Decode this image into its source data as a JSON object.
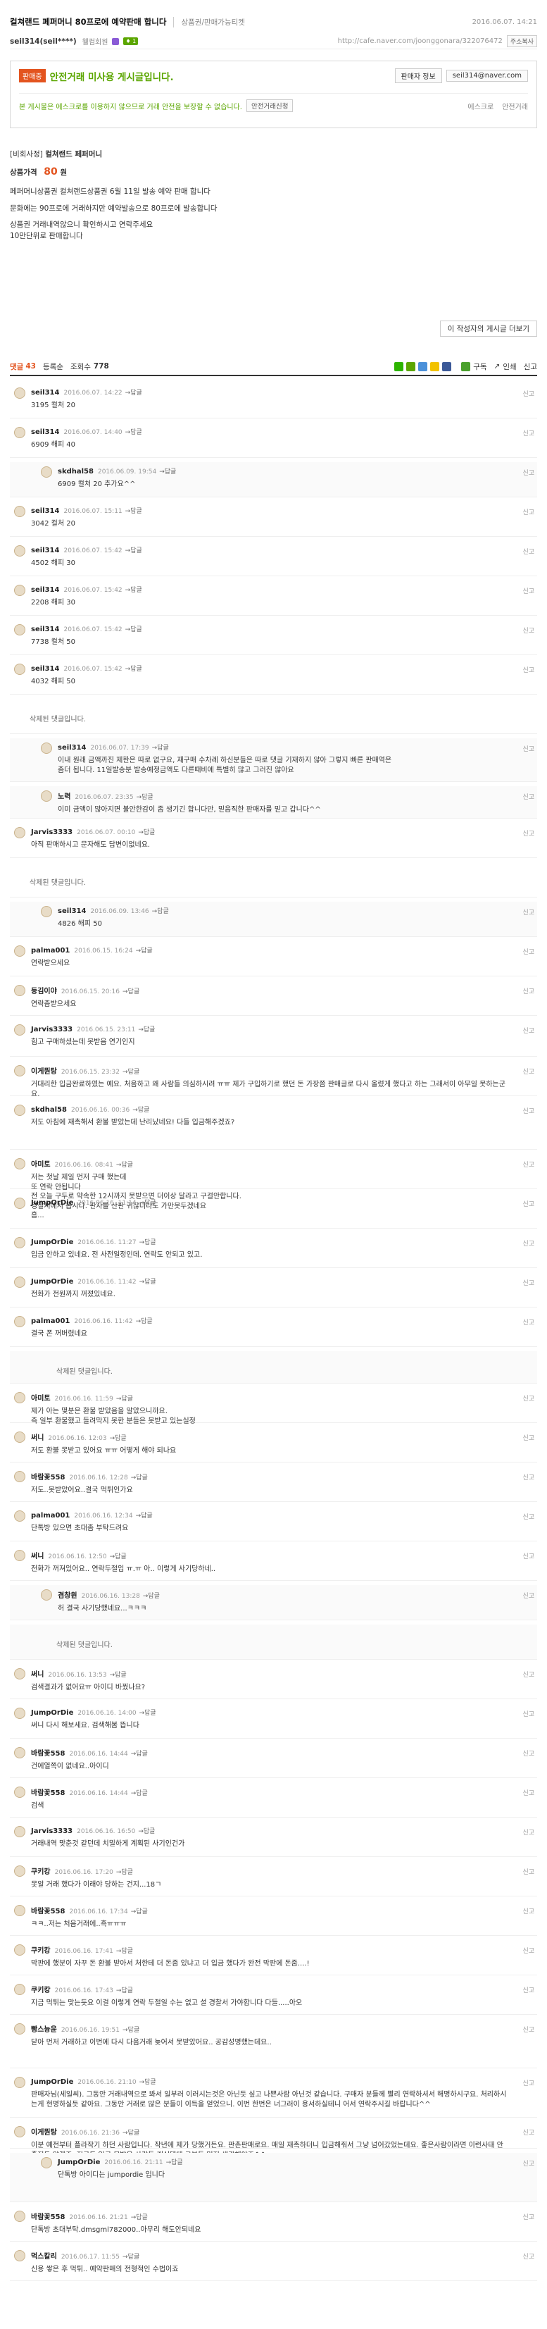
{
  "header": {
    "title": "컬쳐랜드 페퍼머니 80프로에 예약판매 합니다",
    "category": "상품권/판매가능티켓",
    "date": "2016.06.07. 14:21"
  },
  "author": {
    "name": "seil314(seil****)",
    "level": "웰컴회원",
    "badge": "♦ 1",
    "url": "http://cafe.naver.com/joonggonara/322076472",
    "copy": "주소복사"
  },
  "safe": {
    "badge": "판매중",
    "title": "안전거래 미사용 게시글입니다.",
    "seller_info": "판매자 정보",
    "email": "seil314@naver.com",
    "notice": "본 게시물은 에스크로를 이용하지 않으므로 거래 안전을 보장할 수 없습니다.",
    "link": "안전거래신청",
    "escrow": "에스크로",
    "safe_label": "안전거래"
  },
  "post": {
    "tag": "[비회사정]",
    "title": "컬쳐랜드 페퍼머니",
    "price_label": "상품가격",
    "price": "80",
    "price_unit": "원",
    "p1": "페퍼머니상품권 컬쳐랜드상품권 6월 11일 발송 예약 판매 합니다",
    "p2": "문화에는 90프로에 거래하지만 예약발송으로 80프로에 발송합니다",
    "p3": "상품권 거래내역않으니 확인하시고 연락주세요",
    "p4": "10만단위로 판매합니다",
    "more": "이 작성자의 게시글 더보기"
  },
  "comment_bar": {
    "label": "댓글",
    "count": "43",
    "sort": "등록순",
    "views_label": "조회수",
    "views": "778",
    "subscribe": "구독",
    "print": "인쇄",
    "report": "신고"
  },
  "comments": [
    {
      "nick": "seil314",
      "date": "2016.06.07. 14:22",
      "text": "3195 컬처 20"
    },
    {
      "nick": "seil314",
      "date": "2016.06.07. 14:40",
      "text": "6909 해피 40"
    },
    {
      "nick": "skdhal58",
      "date": "2016.06.09. 19:54",
      "text": "6909 컬처 20 추가요^^"
    },
    {
      "nick": "seil314",
      "date": "2016.06.07. 15:11",
      "text": "3042 컬처 20"
    },
    {
      "nick": "seil314",
      "date": "2016.06.07. 15:42",
      "text": "4502 해피 30"
    },
    {
      "nick": "seil314",
      "date": "2016.06.07. 15:42",
      "text": "2208 해피 30"
    },
    {
      "nick": "seil314",
      "date": "2016.06.07. 15:42",
      "text": "7738 컬처 50"
    },
    {
      "nick": "seil314",
      "date": "2016.06.07. 15:42",
      "text": "4032 해피 50"
    },
    {
      "nick": "",
      "date": "",
      "text": "삭제된 댓글입니다."
    },
    {
      "nick": "seil314",
      "date": "2016.06.07. 17:39",
      "text": "이내 원래 금액까진 제한은 따로 없구요, 재구매 수차례 하신분들은 따로 댓글 기재하지 않아 그렇지 빠른 판매역은\n좀더 됩니다. 11일발송분 발송예정금액도 다른때비에 특별히 많고 그러진 않아요"
    },
    {
      "nick": "노력",
      "date": "2016.06.07. 23:35",
      "text": "이미 금액이 많아지면 불안한감이 좀 생기긴 합니다만, 믿음직한 판매자를 믿고 갑니다^^"
    },
    {
      "nick": "Jarvis3333",
      "date": "2016.06.07. 00:10",
      "text": "아직 판매하시고 문자해도 답변이없네요."
    },
    {
      "nick": "",
      "date": "",
      "text": "삭제된 댓글입니다."
    },
    {
      "nick": "seil314",
      "date": "2016.06.09. 13:46",
      "text": "4826 해피 50"
    },
    {
      "nick": "palma001",
      "date": "2016.06.15. 16:24",
      "text": "연락받으세요"
    },
    {
      "nick": "등김이야",
      "date": "2016.06.15. 20:16",
      "text": "연락좀받으세요"
    },
    {
      "nick": "Jarvis3333",
      "date": "2016.06.15. 23:11",
      "text": "힘고 구매하셨는데 못받음 연기인지"
    },
    {
      "nick": "이게뭔탕",
      "date": "2016.06.15. 23:32",
      "text": "거대리한 입금완료하였는 예요. 처음하고 왜 사람들 의심하시려 ㅠㅠ 제가 구입하기로 했던 돈 가장쯤 판매글로 다시 올렸게 했다고 하는 그래서이 아무일 못하는군요."
    },
    {
      "nick": "skdhal58",
      "date": "2016.06.16. 00:36",
      "text": "저도 아침에 재촉해서 환불 받았는데 난리났네요! 다들 입금해주겠죠?"
    },
    {
      "nick": "아미토",
      "date": "2016.06.16. 08:41",
      "text": "저는 첫날 제일 먼저 구매 했는데\n또 연락 안됩니다\n전 오늘 구두로 약속한 12시까지 못받으면 더이상 달라고 구걸안합니다.\n경찰서에서 봅시다. 판자를 산판 귀찮더라도 가만못두겠네요"
    },
    {
      "nick": "JumpOrDie",
      "date": "2016.06.16. 11:14",
      "text": "흠..."
    },
    {
      "nick": "JumpOrDie",
      "date": "2016.06.16. 11:27",
      "text": "입금 안하고 있네요. 전 사전일정인데. 연락도 안되고 있고."
    },
    {
      "nick": "JumpOrDie",
      "date": "2016.06.16. 11:42",
      "text": "전화가 전원까지 꺼졌있네요."
    },
    {
      "nick": "palma001",
      "date": "2016.06.16. 11:42",
      "text": "결국 폰 꺼버렸네요"
    },
    {
      "nick": "",
      "date": "",
      "text": "삭제된 댓글입니다."
    },
    {
      "nick": "아미토",
      "date": "2016.06.16. 11:59",
      "text": "제가 아는 몇분은 환불 받았음을 알았으니까요.\n즉 일부 환불했고 들려막지 못한 분들은 못받고 있는실정"
    },
    {
      "nick": "써니",
      "date": "2016.06.16. 12:03",
      "text": "저도 환불 못받고 있어요 ㅠㅠ 어떻게 해야 되나요"
    },
    {
      "nick": "바람꽃558",
      "date": "2016.06.16. 12:28",
      "text": "저도..못받았어요..결국 먹튀인가요"
    },
    {
      "nick": "palma001",
      "date": "2016.06.16. 12:34",
      "text": "단톡방 있으면 초대좀 부탁드려요"
    },
    {
      "nick": "써니",
      "date": "2016.06.16. 12:50",
      "text": "전화가 꺼져있어요.. 연락두절입 ㅠ.ㅠ 아.. 이렇게 사기당하네.."
    },
    {
      "nick": "겸창원",
      "date": "2016.06.16. 13:28",
      "text": "허 결국 사기당했네요...ㅋㅋㅋ"
    },
    {
      "nick": "",
      "date": "",
      "text": "삭제된 댓글입니다."
    },
    {
      "nick": "써니",
      "date": "2016.06.16. 13:53",
      "text": "검색결과가 없어요ㅠ 아이디 바꿨나요?"
    },
    {
      "nick": "JumpOrDie",
      "date": "2016.06.16. 14:00",
      "text": "써니 다시 해보세요. 검색해봄 뜹니다"
    },
    {
      "nick": "바람꽃558",
      "date": "2016.06.16. 14:44",
      "text": "건에열쪽이 없네요..아이디"
    },
    {
      "nick": "바람꽃558",
      "date": "2016.06.16. 14:44",
      "text": "검색"
    },
    {
      "nick": "Jarvis3333",
      "date": "2016.06.16. 16:50",
      "text": "거래내역 맞춘것 같던데 치밀하게 계획된 사기인건가"
    },
    {
      "nick": "쿠키캉",
      "date": "2016.06.16. 17:20",
      "text": "못알 거래 했다가 이래야 당하는 건지...18ㄱ"
    },
    {
      "nick": "바람꽃558",
      "date": "2016.06.16. 17:34",
      "text": "ㅋㅋ..저는 처음거래에..흑ㅠㅠㅠ"
    },
    {
      "nick": "쿠키캉",
      "date": "2016.06.16. 17:41",
      "text": "막판에 했분이 자꾸 돈 환불 받아서 처한테 더 돈줌 있냐고 더 입금 했다가 완전 막판에 돈줌....!"
    },
    {
      "nick": "쿠키캉",
      "date": "2016.06.16. 17:43",
      "text": "지금 먹튀는 맞는듯요 이걸 이렇게 연락 두절일 수는 없고 설 경찰서 가야합니다 다들.....아오"
    },
    {
      "nick": "빵스늉윤",
      "date": "2016.06.16. 19:51",
      "text": "닫아 먼저 거래하고 이번에 다시 다음거래 늦어서 못받았어요.. 공감성명했는데요.."
    },
    {
      "nick": "JumpOrDie",
      "date": "2016.06.16. 21:10",
      "text": "판매자님(세일씨). 그동안 거래내역으로 봐서 일부러 이러시는것은 아닌듯 싶고 나쁜사람 아닌것 같습니다. 구매자 분들께 빨리 연락하셔서 해명하시구요. 처리하시는게 현명하실듯 같아요. 그동안 거래로 많은 분들이 이득을 얻었으니. 이번 한번은 너그러이 용서하실테니 어서 연락주시길 바랍니다^^"
    },
    {
      "nick": "이게뭔탕",
      "date": "2016.06.16. 21:36",
      "text": "이분 예전부터 플라작기 하던 사람입니다. 작년에 제가 당했거든요. 판촌판매로요. 매일 재촉하더니 입금해줘서 그냥 넘어갔었는데요. 좋은사람이라면 이런사태 안좋지도 않겠죠. 지금도 입금 못받은 사람들 계실텐데 그분들 먼저 생각해야죠^^"
    },
    {
      "nick": "JumpOrDie",
      "date": "2016.06.16. 21:11",
      "text": "단톡방 아이디는 jumpordie 입니다"
    },
    {
      "nick": "바람꽃558",
      "date": "2016.06.16. 21:21",
      "text": "단톡방 초대부탁.dmsgml782000..아무리 해도안되네요"
    },
    {
      "nick": "먹스칼리",
      "date": "2016.06.17. 11:55",
      "text": "신용 쌓은 후 먹튀.. 예약판매의 전형적인 수법이죠"
    }
  ],
  "ui": {
    "reply_label": "답글",
    "report_label": "신고",
    "avatar_icon": "user-avatar-icon"
  }
}
